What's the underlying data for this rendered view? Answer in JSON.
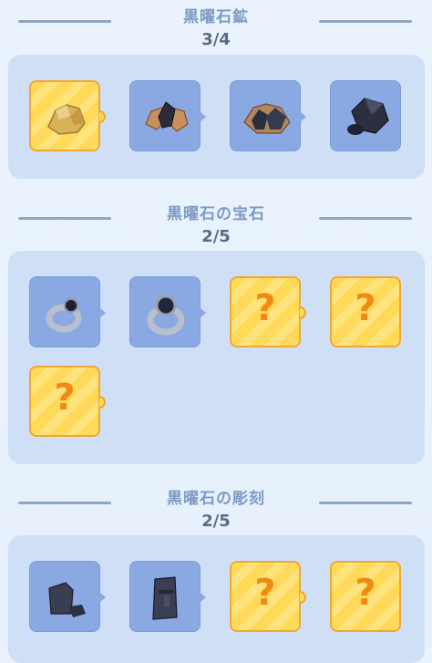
{
  "sections": [
    {
      "title": "黒曜石鉱",
      "count": "3/4",
      "items": [
        {
          "state": "found",
          "icon": "gold-ore-icon",
          "highlight": true
        },
        {
          "state": "found",
          "icon": "obsidian-ore-icon"
        },
        {
          "state": "found",
          "icon": "obsidian-ore-large-icon"
        },
        {
          "state": "found",
          "icon": "obsidian-crystal-icon"
        }
      ]
    },
    {
      "title": "黒曜石の宝石",
      "count": "2/5",
      "items": [
        {
          "state": "found",
          "icon": "obsidian-ring-icon"
        },
        {
          "state": "found",
          "icon": "obsidian-ring-large-icon"
        },
        {
          "state": "locked",
          "label": "?"
        },
        {
          "state": "locked",
          "label": "?"
        },
        {
          "state": "locked",
          "label": "?"
        }
      ]
    },
    {
      "title": "黒曜石の彫刻",
      "count": "2/5",
      "items": [
        {
          "state": "found",
          "icon": "obsidian-stone-block-icon"
        },
        {
          "state": "found",
          "icon": "obsidian-statue-head-icon"
        },
        {
          "state": "locked",
          "label": "?"
        },
        {
          "state": "locked",
          "label": "?"
        }
      ]
    }
  ]
}
